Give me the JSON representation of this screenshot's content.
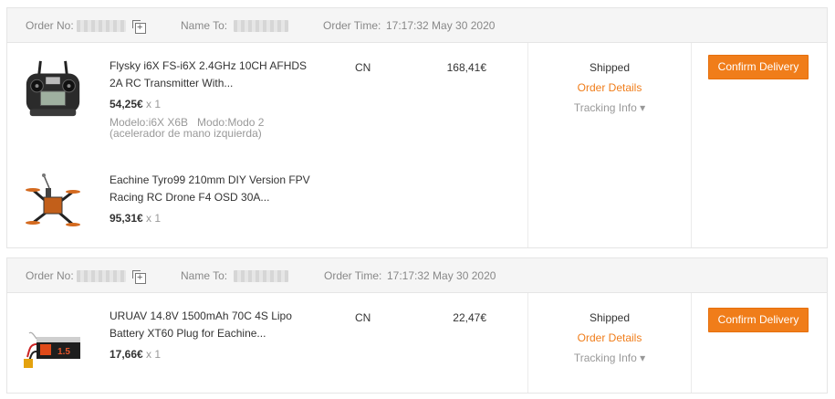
{
  "orders": [
    {
      "order_no_label": "Order No:",
      "name_to_label": "Name To:",
      "order_time_label": "Order Time:",
      "order_time": "17:17:32 May 30 2020",
      "items": [
        {
          "title": "Flysky i6X FS-i6X 2.4GHz 10CH AFHDS 2A RC Transmitter With...",
          "price": "54,25€",
          "qty": "x 1",
          "attrs": "Modelo:i6X X6B   Modo:Modo 2 (acelerador de mano izquierda)",
          "image": "rc-transmitter"
        },
        {
          "title": "Eachine Tyro99 210mm DIY Version FPV Racing RC Drone F4 OSD 30A...",
          "price": "95,31€",
          "qty": "x 1",
          "image": "fpv-drone"
        }
      ],
      "ship_to": "CN",
      "total": "168,41€",
      "status": "Shipped",
      "order_details": "Order Details",
      "tracking_info": "Tracking Info ▾",
      "confirm_button": "Confirm Delivery"
    },
    {
      "order_no_label": "Order No:",
      "name_to_label": "Name To:",
      "order_time_label": "Order Time:",
      "order_time": "17:17:32 May 30 2020",
      "items": [
        {
          "title": "URUAV 14.8V 1500mAh 70C 4S Lipo Battery XT60 Plug for Eachine...",
          "price": "17,66€",
          "qty": "x 1",
          "image": "lipo-battery",
          "battery_label": "1.5"
        }
      ],
      "ship_to": "CN",
      "total": "22,47€",
      "status": "Shipped",
      "order_details": "Order Details",
      "tracking_info": "Tracking Info ▾",
      "confirm_button": "Confirm Delivery"
    }
  ],
  "colors": {
    "accent": "#f07d1a",
    "header_bg": "#f5f5f5",
    "border": "#e5e5e5",
    "muted_text": "#999999"
  }
}
